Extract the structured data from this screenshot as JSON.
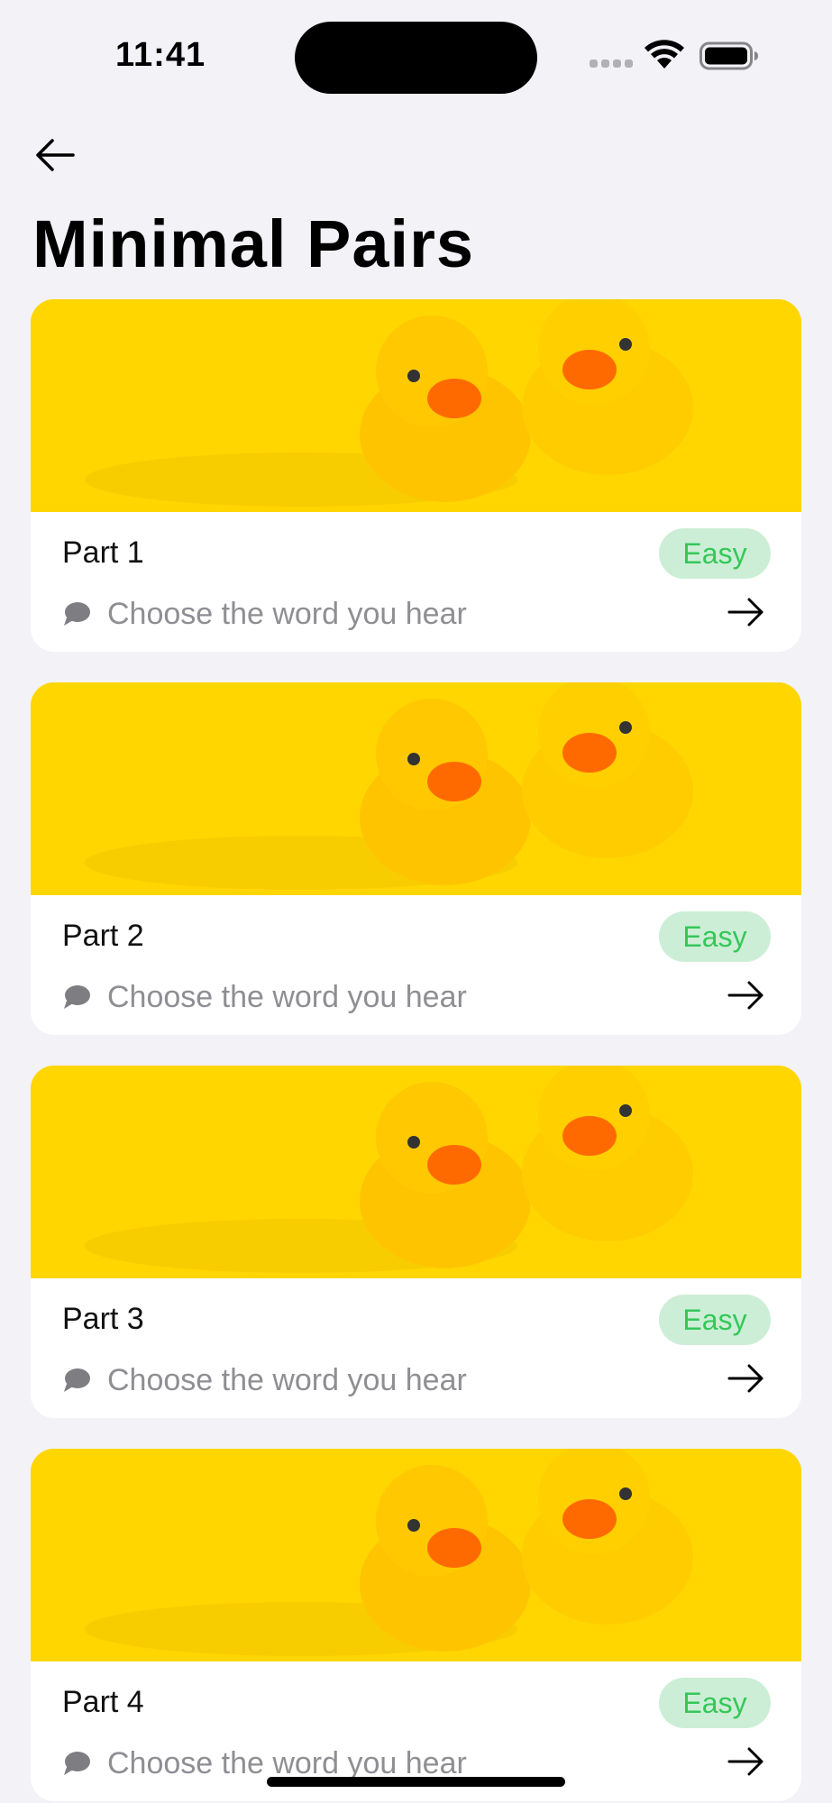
{
  "status_bar": {
    "time": "11:41"
  },
  "header": {
    "title": "Minimal Pairs"
  },
  "cards": [
    {
      "title": "Part 1",
      "difficulty": "Easy",
      "subtitle": "Choose the word you hear"
    },
    {
      "title": "Part 2",
      "difficulty": "Easy",
      "subtitle": "Choose the word you hear"
    },
    {
      "title": "Part 3",
      "difficulty": "Easy",
      "subtitle": "Choose the word you hear"
    },
    {
      "title": "Part 4",
      "difficulty": "Easy",
      "subtitle": "Choose the word you hear"
    }
  ],
  "icons": {
    "back": "arrow-left-icon",
    "card_action": "arrow-right-icon",
    "subtitle": "speech-bubble-icon",
    "image": "rubber-ducks-image"
  },
  "colors": {
    "background": "#f2f2f7",
    "image_yellow": "#ffd600",
    "badge_bg": "#cdeed6",
    "badge_text": "#34c759",
    "subtitle_gray": "#8e8e93"
  }
}
